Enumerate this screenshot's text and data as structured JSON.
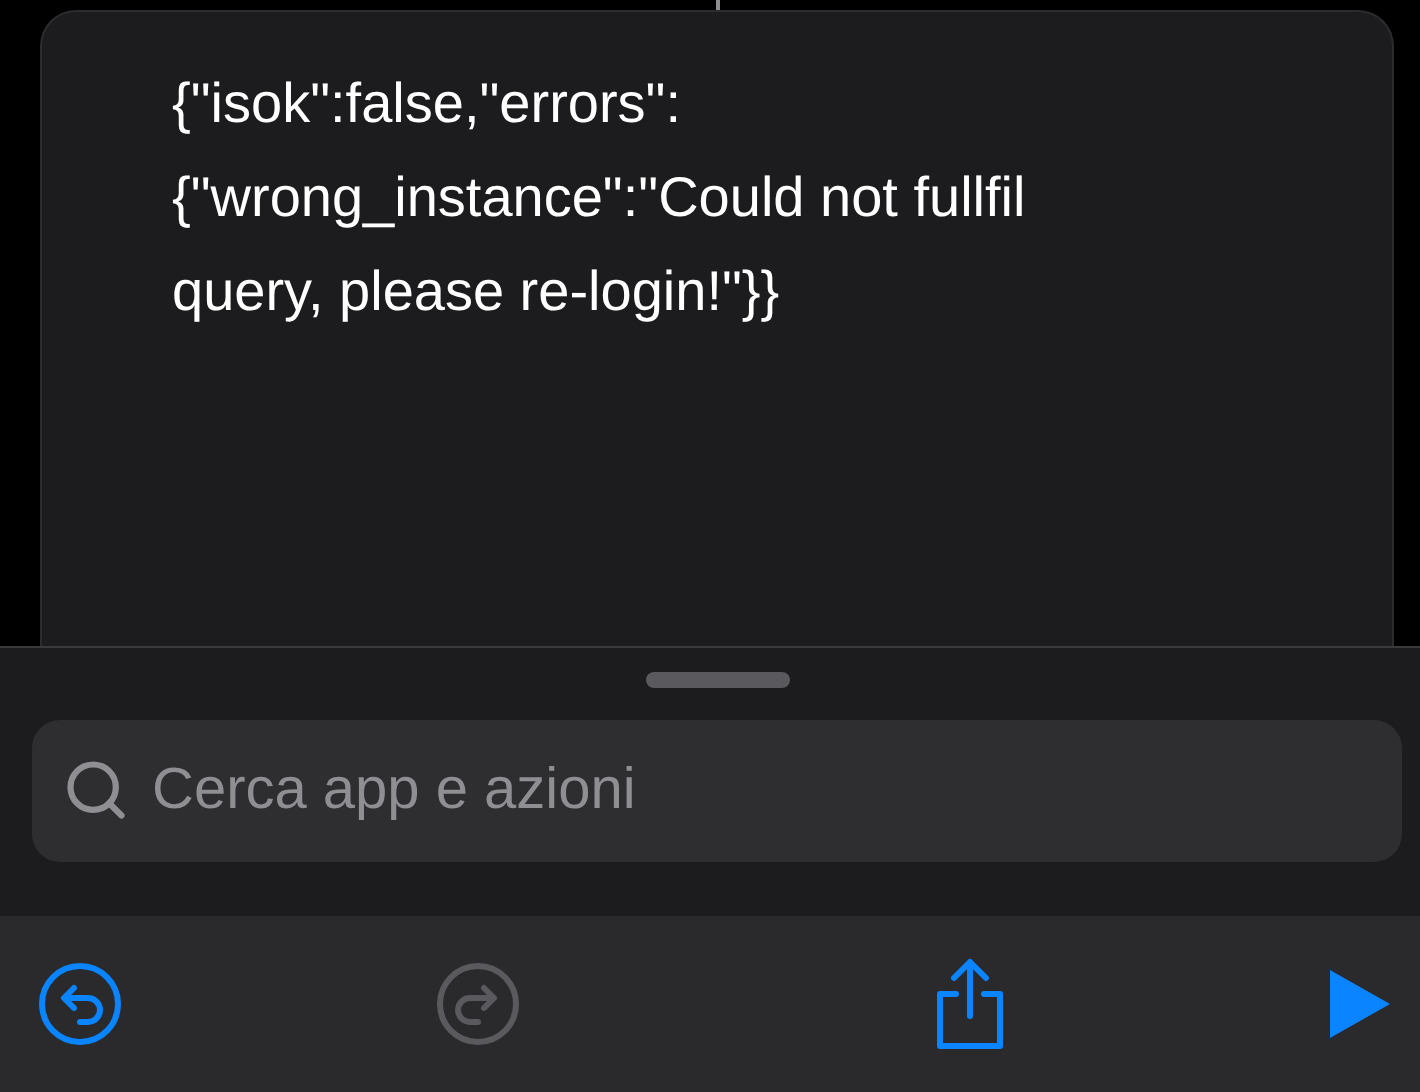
{
  "output": {
    "lines": [
      "{\"isok\":false,\"errors\":",
      "{\"wrong_instance\":\"Could not fullfil",
      "query, please re-login!\"}}"
    ]
  },
  "search": {
    "placeholder": "Cerca app e azioni"
  },
  "toolbar": [
    {
      "kind": "undo",
      "disabled": false
    },
    {
      "kind": "redo",
      "disabled": true
    },
    {
      "kind": "share",
      "disabled": false
    },
    {
      "kind": "run",
      "disabled": false
    }
  ]
}
